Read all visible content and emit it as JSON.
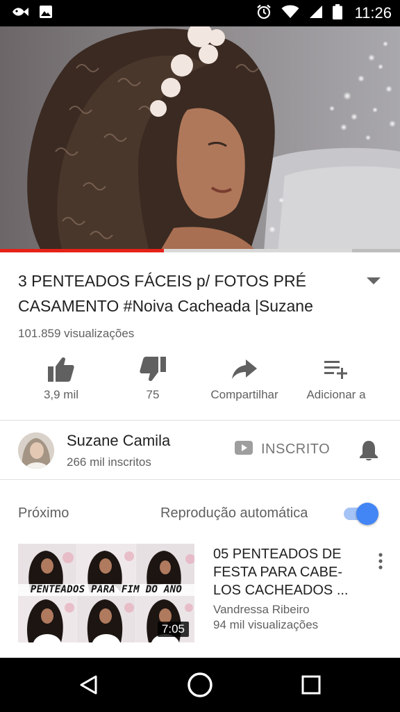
{
  "status_bar": {
    "time": "11:26",
    "left_icons": [
      "fish-icon",
      "image-icon"
    ],
    "right_icons": [
      "alarm-icon",
      "wifi-icon",
      "signal-icon",
      "battery-icon"
    ]
  },
  "player": {
    "progress_fraction": 0.41,
    "buffered_fraction": 0.88,
    "accent_color": "#e62117"
  },
  "video": {
    "title": "3 PENTEADOS FÁCEIS p/ FOTOS PRÉ CASAMENTO #Noiva Cacheada |Suzane",
    "views": "101.859 visualizações"
  },
  "actions": [
    {
      "icon": "thumbs-up-icon",
      "label": "3,9 mil"
    },
    {
      "icon": "thumbs-down-icon",
      "label": "75"
    },
    {
      "icon": "share-icon",
      "label": "Compartilhar"
    },
    {
      "icon": "add-to-playlist-icon",
      "label": "Adicionar a"
    }
  ],
  "channel": {
    "name": "Suzane Camila",
    "subscribers": "266 mil inscritos",
    "subscribed_label": "INSCRITO"
  },
  "up_next": {
    "label": "Próximo",
    "autoplay_label": "Reprodução automática",
    "autoplay_on": true,
    "toggle_color": "#4285f4"
  },
  "recommended": {
    "thumbnail_caption": "PENTEADOS PARA FIM DO ANO",
    "duration": "7:05",
    "title": "05 PENTEADOS DE FESTA PARA CABE-LOS CACHEADOS ...",
    "channel": "Vandressa Ribeiro",
    "views": "94 mil visualizações"
  },
  "nav_bar": {
    "buttons": [
      "back-icon",
      "home-icon",
      "recents-icon"
    ]
  }
}
